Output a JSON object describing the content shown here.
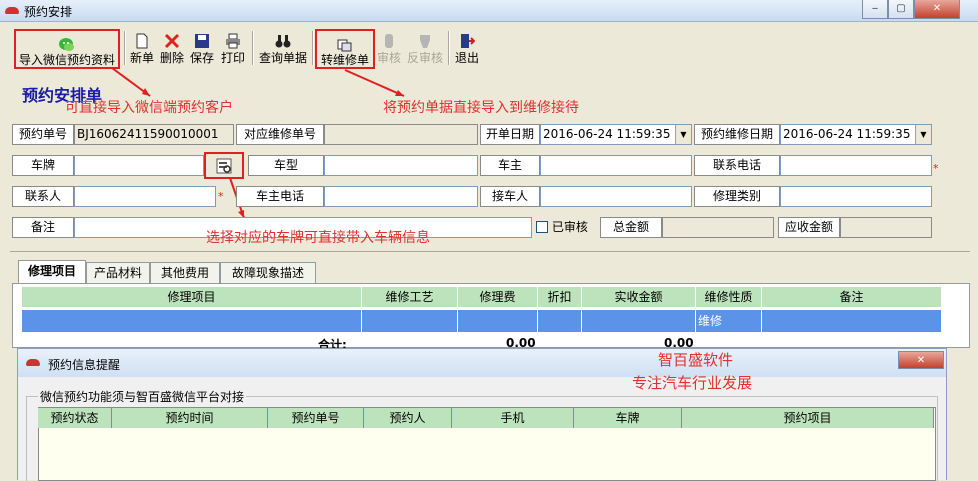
{
  "window": {
    "title": "预约安排",
    "min_label": "‒",
    "max_label": "▢",
    "close_label": "✕"
  },
  "toolbar": {
    "import_wechat": "导入微信预约资料",
    "new": "新单",
    "delete": "删除",
    "save": "保存",
    "print": "打印",
    "query": "查询单据",
    "transfer": "转维修单",
    "audit": "审核",
    "unaudit": "反审核",
    "exit": "退出"
  },
  "form": {
    "title": "预约安排单",
    "order_no_label": "预约单号",
    "order_no": "BJ16062411590010001",
    "repair_no_label": "对应维修单号",
    "repair_no": "",
    "open_date_label": "开单日期",
    "open_date": "2016-06-24 11:59:35",
    "appt_date_label": "预约维修日期",
    "appt_date": "2016-06-24 11:59:35",
    "plate_label": "车牌",
    "plate": "",
    "model_label": "车型",
    "model": "",
    "owner_label": "车主",
    "owner": "",
    "phone_label": "联系电话",
    "phone": "",
    "contact_label": "联系人",
    "contact": "",
    "owner_phone_label": "车主电话",
    "owner_phone": "",
    "receiver_label": "接车人",
    "receiver": "",
    "repair_type_label": "修理类别",
    "repair_type": "",
    "note_label": "备注",
    "note": "",
    "audited_label": "已审核",
    "total_label": "总金额",
    "total": "",
    "receivable_label": "应收金额",
    "receivable": "",
    "required_mark": "*"
  },
  "annotations": {
    "import_note": "可直接导入微信端预约客户",
    "transfer_note": "将预约单据直接导入到维修接待",
    "plate_note": "选择对应的车牌可直接带入车辆信息",
    "watermark_line1": "智百盛软件",
    "watermark_line2": "专注汽车行业发展"
  },
  "tabs": [
    "修理项目",
    "产品材料",
    "其他费用",
    "故障现象描述"
  ],
  "repair_grid": {
    "columns": [
      "修理项目",
      "维修工艺",
      "修理费",
      "折扣",
      "实收金额",
      "维修性质",
      "备注"
    ],
    "row": [
      "",
      "",
      "",
      "",
      "",
      "维修",
      ""
    ],
    "total_label": "合计:",
    "total_fee": "0.00",
    "total_received": "0.00"
  },
  "dialog": {
    "title": "预约信息提醒",
    "group_label": "微信预约功能须与智百盛微信平台对接",
    "columns": [
      "预约状态",
      "预约时间",
      "预约单号",
      "预约人",
      "手机",
      "车牌",
      "预约项目"
    ],
    "close_label": "✕"
  }
}
